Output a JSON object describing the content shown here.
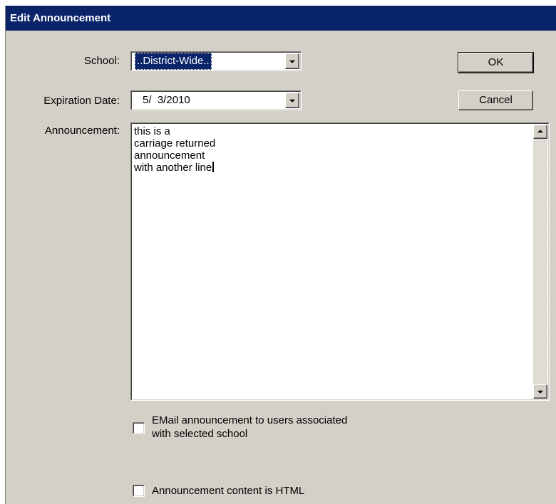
{
  "dialog": {
    "title": "Edit Announcement"
  },
  "form": {
    "school_label": "School:",
    "school_value": "..District-Wide..",
    "expiration_label": "Expiration Date:",
    "expiration_value": "5/  3/2010",
    "announcement_label": "Announcement:",
    "announcement_text": "this is a\ncarriage returned\nannouncement\nwith another line",
    "email_checkbox_label": "EMail announcement to users associated\nwith selected school",
    "email_checked": false,
    "html_checkbox_label": "Announcement content is HTML",
    "html_checked": false
  },
  "buttons": {
    "ok_label": "OK",
    "cancel_label": "Cancel"
  },
  "icons": {
    "dropdown": "chevron-down-icon",
    "scroll_up": "scroll-up-icon",
    "scroll_down": "scroll-down-icon"
  },
  "colors": {
    "titlebar": "#0a246a",
    "dialog_face": "#d4d0c8",
    "selection": "#0a246a"
  }
}
